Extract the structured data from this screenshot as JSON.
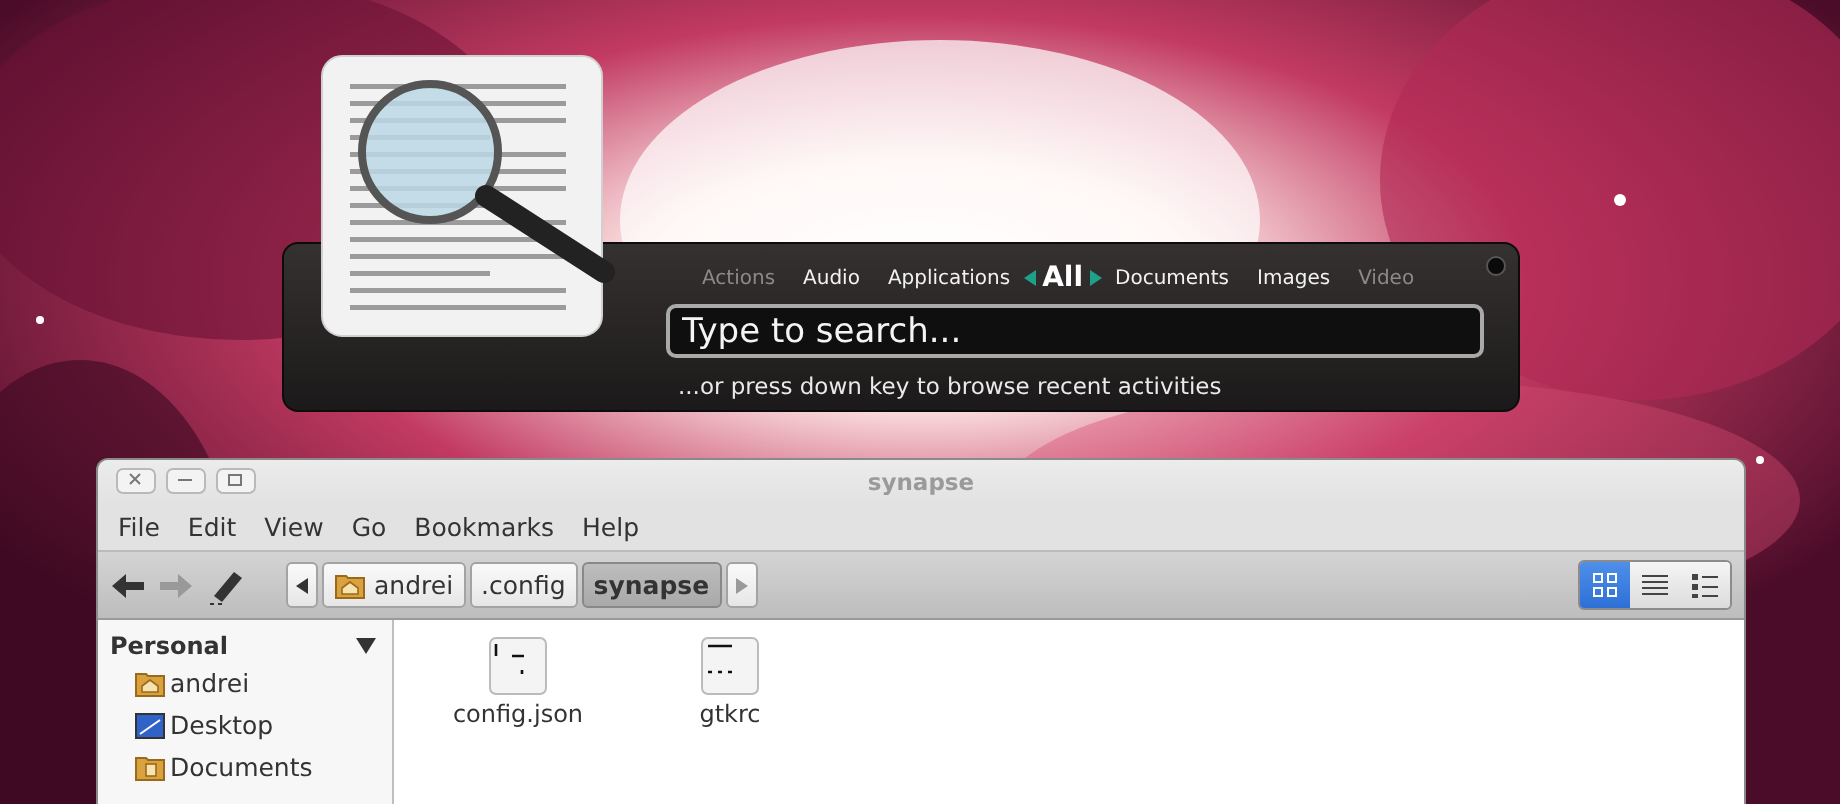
{
  "launcher": {
    "categories": [
      {
        "label": "Actions",
        "selected": false,
        "disabled": true
      },
      {
        "label": "Audio",
        "selected": false,
        "disabled": false
      },
      {
        "label": "Applications",
        "selected": false,
        "disabled": false
      },
      {
        "label": "All",
        "selected": true,
        "disabled": false
      },
      {
        "label": "Documents",
        "selected": false,
        "disabled": false
      },
      {
        "label": "Images",
        "selected": false,
        "disabled": false
      },
      {
        "label": "Video",
        "selected": false,
        "disabled": true
      }
    ],
    "search": {
      "placeholder": "Type to search..."
    },
    "hint": "...or press down key to browse recent activities"
  },
  "window": {
    "title": "synapse",
    "menu": [
      "File",
      "Edit",
      "View",
      "Go",
      "Bookmarks",
      "Help"
    ],
    "path": [
      {
        "label": "andrei",
        "kind": "home",
        "selected": false
      },
      {
        "label": ".config",
        "kind": "folder",
        "selected": false
      },
      {
        "label": "synapse",
        "kind": "folder",
        "selected": true
      }
    ],
    "views": [
      {
        "kind": "icons",
        "selected": true
      },
      {
        "kind": "compact",
        "selected": false
      },
      {
        "kind": "list",
        "selected": false
      }
    ],
    "sidebar": {
      "heading": "Personal",
      "expanded": true,
      "items": [
        {
          "label": "andrei",
          "kind": "home"
        },
        {
          "label": "Desktop",
          "kind": "desktop"
        },
        {
          "label": "Documents",
          "kind": "documents"
        }
      ]
    },
    "files": [
      {
        "name": "config.json"
      },
      {
        "name": "gtkrc"
      }
    ]
  }
}
